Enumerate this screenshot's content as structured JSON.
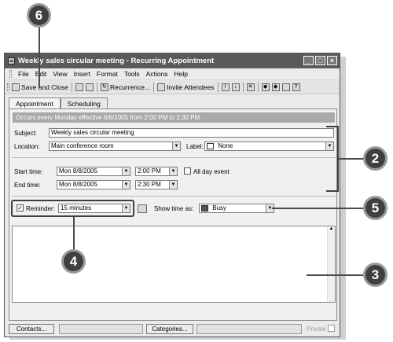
{
  "window": {
    "title": "Weekly sales circular meeting - Recurring Appointment",
    "buttons": [
      "_",
      "□",
      "×"
    ]
  },
  "menus": [
    "File",
    "Edit",
    "View",
    "Insert",
    "Format",
    "Tools",
    "Actions",
    "Help"
  ],
  "toolbar": {
    "save_close": "Save and Close",
    "recurrence": "Recurrence...",
    "invite": "Invite Attendees"
  },
  "tabs": [
    "Appointment",
    "Scheduling"
  ],
  "info": "Occurs every Monday effective 6/6/2005 from 2:00 PM to 2:30 PM.",
  "form": {
    "subject_label": "Subject:",
    "subject_value": "Weekly sales circular meeting",
    "location_label": "Location:",
    "location_value": "Main conference room",
    "label_label": "Label:",
    "label_value": "None",
    "start_label": "Start time:",
    "start_date": "Mon 8/8/2005",
    "start_time": "2:00 PM",
    "allday_label": "All day event",
    "end_label": "End time:",
    "end_date": "Mon 8/8/2005",
    "end_time": "2:30 PM",
    "reminder_label": "Reminder:",
    "reminder_value": "15 minutes",
    "reminder_checked": "✓",
    "showtime_label": "Show time as:",
    "showtime_value": "Busy"
  },
  "bottom": {
    "contacts": "Contacts...",
    "categories": "Categories...",
    "private": "Private"
  },
  "callouts": {
    "c6": "6",
    "c2": "2",
    "c5": "5",
    "c3": "3",
    "c4": "4"
  },
  "colors": {
    "titlebar": "#5a5a5a",
    "callout": "#3f3f3f",
    "busy": "#555555"
  }
}
